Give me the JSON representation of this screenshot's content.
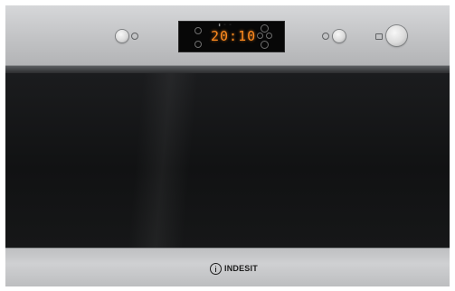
{
  "display": {
    "readout": "20:10"
  },
  "brand": {
    "name": "INDESIT"
  },
  "colors": {
    "display_digits": "#ff8a1f",
    "panel": "#c9cacc",
    "door_glass": "#141516"
  },
  "icons": {
    "left_knob": "round-control-knob",
    "right_knob": "round-control-knob",
    "start": "play-icon",
    "auto_program": "square-icon",
    "mode": "mode-icon",
    "timer": "timer-icon",
    "up_arrow": "arrow-up-icon",
    "down_arrow": "arrow-down-icon",
    "center_nav": "nav-cross-icon"
  }
}
